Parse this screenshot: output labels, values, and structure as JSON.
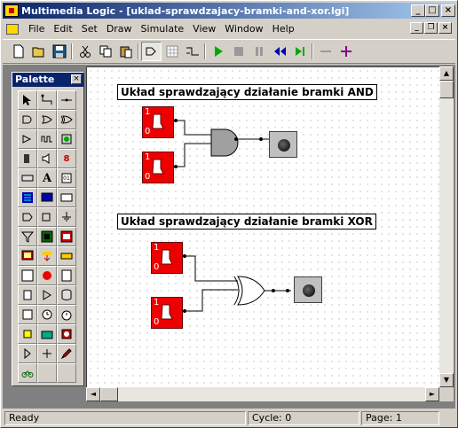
{
  "window": {
    "title": "Multimedia Logic - [uklad-sprawdzajacy-bramki-and-xor.lgi]"
  },
  "menu": {
    "items": [
      "File",
      "Edit",
      "Set",
      "Draw",
      "Simulate",
      "View",
      "Window",
      "Help"
    ]
  },
  "toolbar": {
    "icons": [
      "new-icon",
      "open-icon",
      "save-icon",
      "cut-icon",
      "copy-icon",
      "paste-icon",
      "draw-mode-icon",
      "grid-icon",
      "wire-icon",
      "run-icon",
      "stop-icon",
      "pause-icon",
      "step-back-icon",
      "step-forward-icon",
      "zoom-out-icon",
      "zoom-in-icon"
    ]
  },
  "palette": {
    "title": "Palette"
  },
  "canvas": {
    "and_label": "Układ sprawdzający działanie bramki AND",
    "xor_label": "Układ sprawdzający działanie bramki XOR",
    "switch_one": "1",
    "switch_zero": "0"
  },
  "status": {
    "ready": "Ready",
    "cycle": "Cycle: 0",
    "page": "Page: 1"
  }
}
